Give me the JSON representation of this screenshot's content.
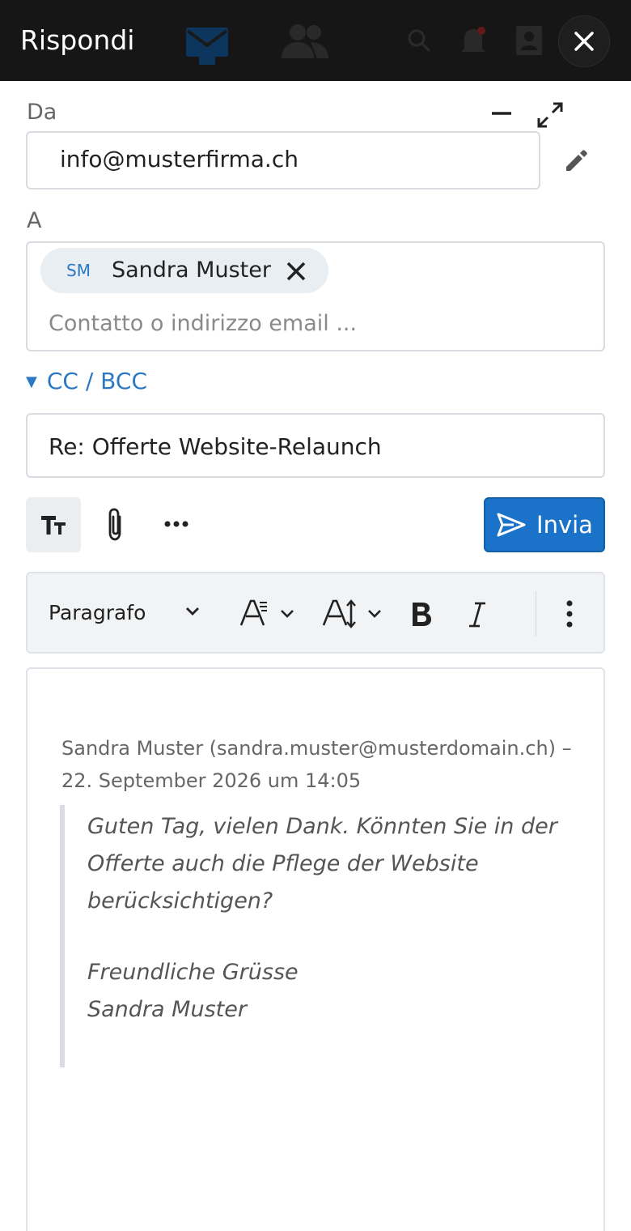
{
  "header": {
    "title": "Rispondi"
  },
  "from": {
    "label": "Da",
    "value": "info@musterfirma.ch"
  },
  "to": {
    "label": "A",
    "recipients": [
      {
        "initials": "SM",
        "name": "Sandra Muster"
      }
    ],
    "placeholder": "Contatto o indirizzo email ..."
  },
  "cc_bcc": {
    "label": "CC / BCC"
  },
  "subject": {
    "value": "Re: Offerte Website-Relaunch"
  },
  "toolbar": {
    "send_label": "Invia"
  },
  "format_bar": {
    "paragraph_label": "Paragrafo"
  },
  "quote": {
    "header": "Sandra Muster (sandra.muster@musterdomain.ch) – 22. September 2026 um 14:05",
    "lines": [
      "Guten Tag, vielen Dank. Könnten Sie in der Offerte auch die Pflege der Website berücksichtigen?",
      "Freundliche Grüsse",
      "Sandra Muster"
    ]
  },
  "colors": {
    "accent": "#1a73c8",
    "topbar": "#161616",
    "link": "#2a79c2"
  },
  "icons": [
    "mail-icon",
    "people-icon",
    "search-icon",
    "bell-icon",
    "contacts-icon",
    "close-icon",
    "minimize-icon",
    "expand-icon",
    "pencil-icon",
    "remove-recipient-icon",
    "text-format-icon",
    "paperclip-icon",
    "more-horizontal-icon",
    "send-icon",
    "font-size-icon",
    "line-height-icon",
    "bold-icon",
    "italic-icon",
    "more-vertical-icon"
  ]
}
